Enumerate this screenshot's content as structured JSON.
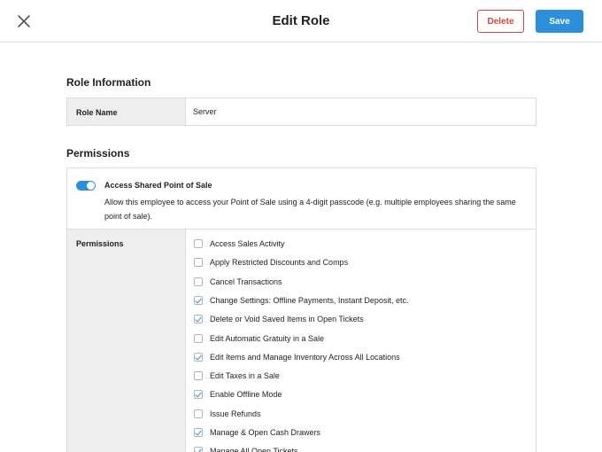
{
  "header": {
    "title": "Edit Role",
    "delete_label": "Delete",
    "save_label": "Save",
    "close_icon": "close-icon"
  },
  "role_info": {
    "heading": "Role Information",
    "name_label": "Role Name",
    "name_value": "Server"
  },
  "permissions": {
    "heading": "Permissions",
    "shared_pos": {
      "title": "Access Shared Point of Sale",
      "description": "Allow this employee to access your Point of Sale using a 4-digit passcode (e.g. multiple employees sharing the same point of sale).",
      "enabled": true
    },
    "list_label": "Permissions",
    "items": [
      {
        "label": "Access Sales Activity",
        "checked": false
      },
      {
        "label": "Apply Restricted Discounts and Comps",
        "checked": false
      },
      {
        "label": "Cancel Transactions",
        "checked": false
      },
      {
        "label": "Change Settings: Offline Payments, Instant Deposit, etc.",
        "checked": true
      },
      {
        "label": "Delete or Void Saved Items in Open Tickets",
        "checked": true
      },
      {
        "label": "Edit Automatic Gratuity in a Sale",
        "checked": false
      },
      {
        "label": "Edit Items and Manage Inventory Across All Locations",
        "checked": true
      },
      {
        "label": "Edit Taxes in a Sale",
        "checked": false
      },
      {
        "label": "Enable Offline Mode",
        "checked": true
      },
      {
        "label": "Issue Refunds",
        "checked": false
      },
      {
        "label": "Manage & Open Cash Drawers",
        "checked": true
      },
      {
        "label": "Manage All Open Tickets",
        "checked": true
      }
    ]
  },
  "colors": {
    "accent": "#2b8fdb",
    "danger": "#d0453d",
    "label_bg": "#eeeeee",
    "border": "#dcdcdc"
  }
}
